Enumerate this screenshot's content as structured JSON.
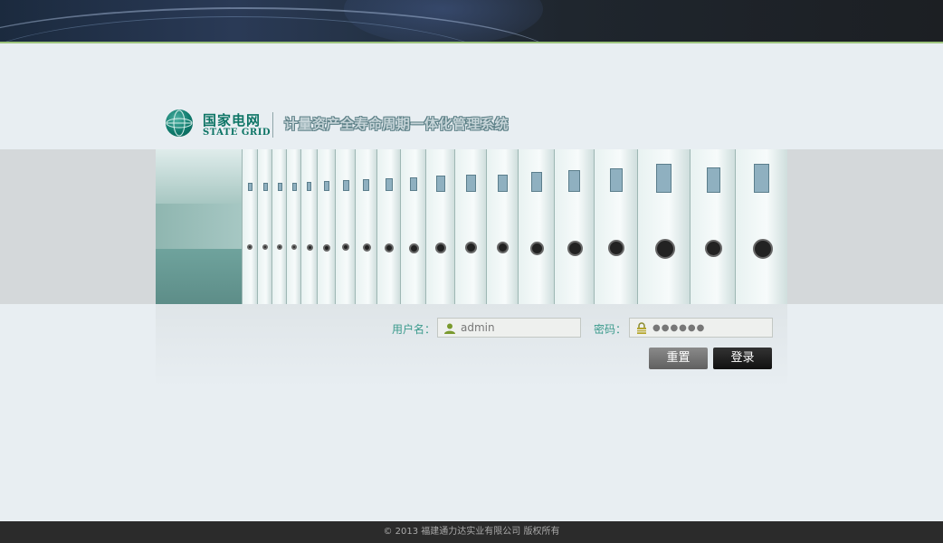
{
  "brand": {
    "name_cn": "国家电网",
    "name_en": "STATE GRID",
    "system_title": "计量资产全寿命周期一体化管理系统"
  },
  "login": {
    "username_label": "用户名：",
    "username_value": "admin",
    "password_label": "密码：",
    "password_mask": "●●●●●●",
    "reset_label": "重置",
    "login_label": "登录"
  },
  "footer": {
    "copyright": "© 2013 福建通力达实业有限公司 版权所有"
  },
  "colors": {
    "accent_green": "#3a9a8c",
    "brand_teal": "#0e7566"
  },
  "icons": [
    "globe-logo-icon",
    "user-icon",
    "lock-icon"
  ]
}
